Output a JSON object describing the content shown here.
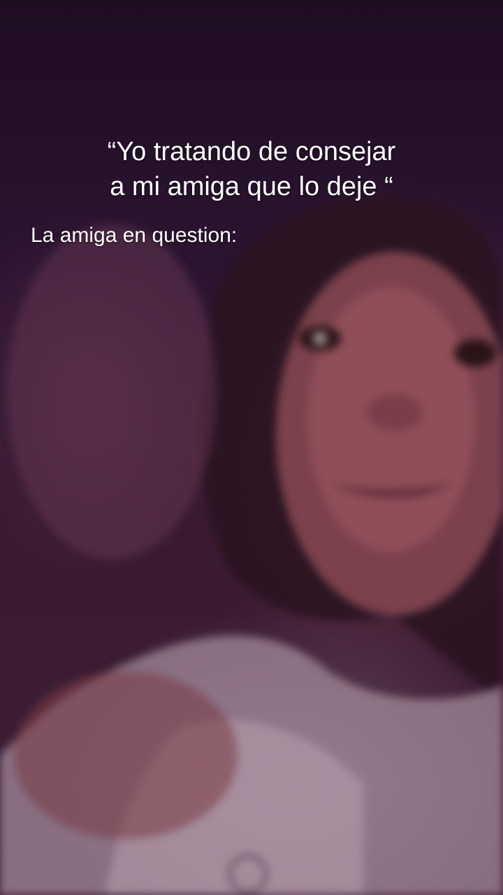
{
  "overlay": {
    "quote_line_1": "“Yo tratando de consejar",
    "quote_line_2": "a mi amiga que lo deje “",
    "subtitle": "La amiga en question:"
  },
  "colors": {
    "background_top": "#1f0d22",
    "background_bottom": "#3e2036",
    "text": "#ffffff"
  }
}
